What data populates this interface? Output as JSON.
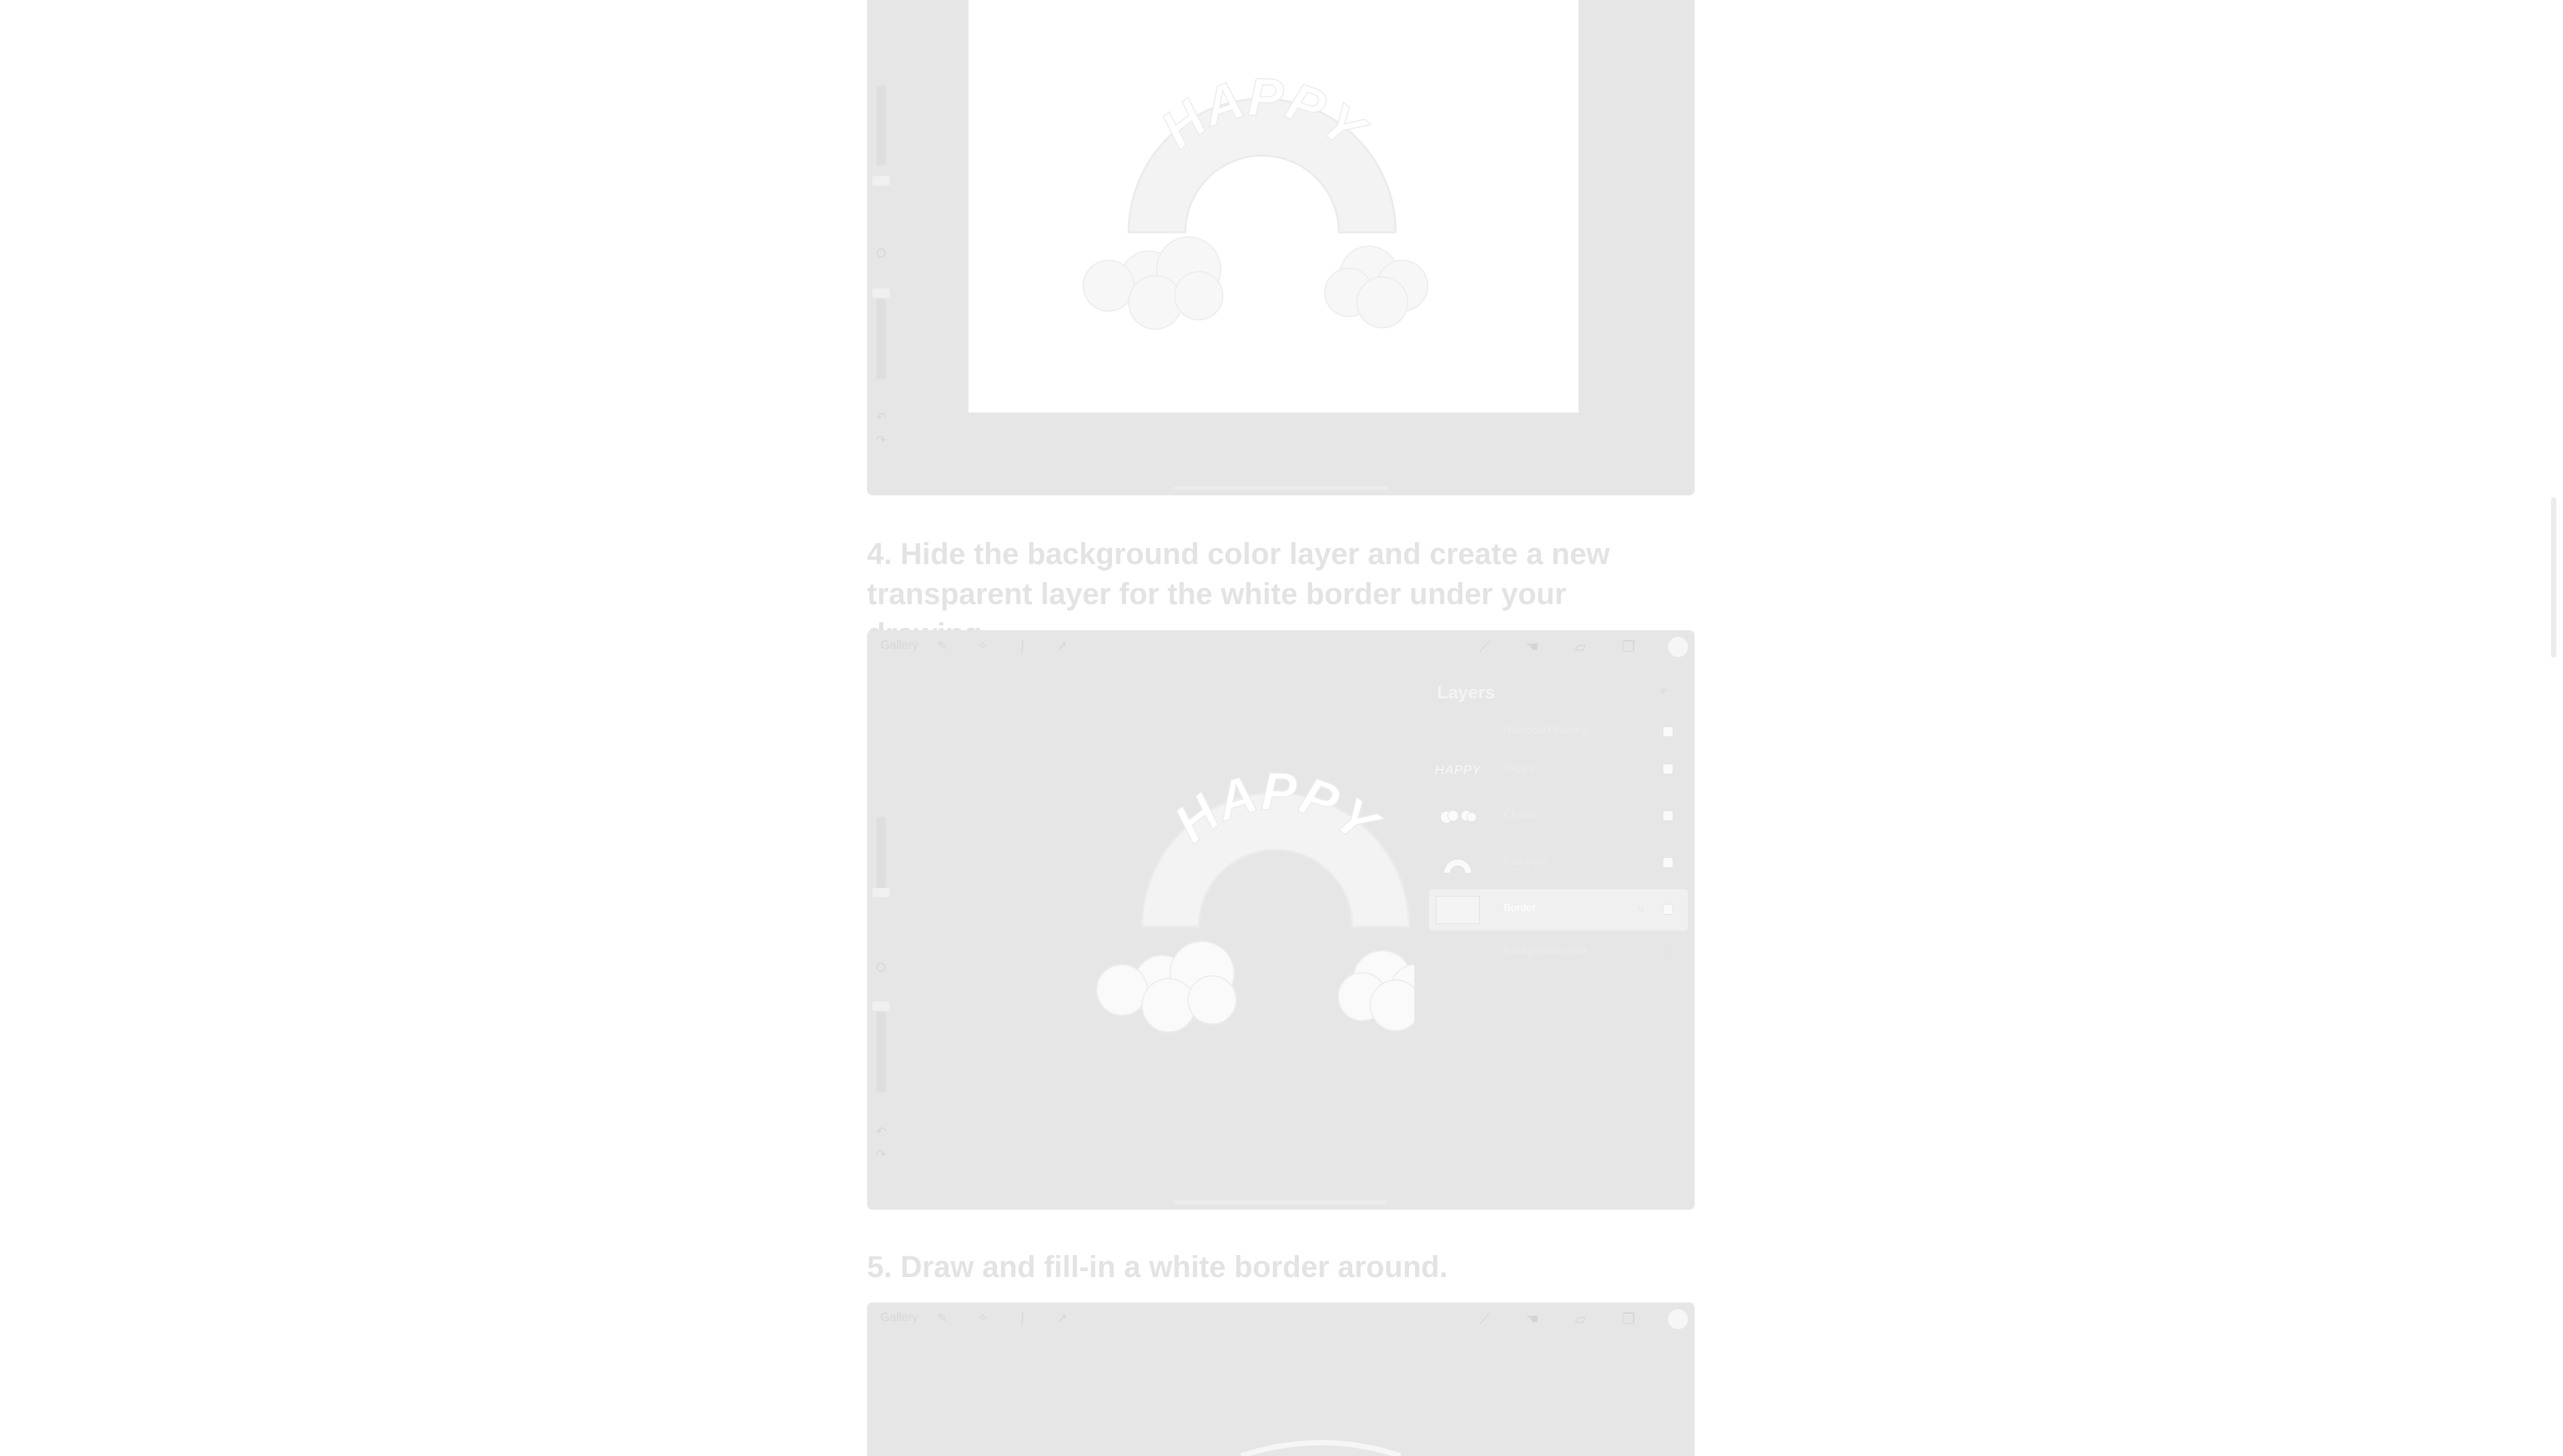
{
  "steps": [
    {
      "heading": "4. Hide the background color layer and create a new transparent layer for the white border under your drawing."
    },
    {
      "heading": "5. Draw and fill-in a white border around."
    }
  ],
  "app_toolbar": {
    "gallery_label": "Gallery",
    "tools_left": [
      "wrench-icon",
      "magic-wand-icon",
      "selection-icon",
      "transform-arrow-icon"
    ],
    "tools_right": [
      "brush-icon",
      "smudge-icon",
      "eraser-icon",
      "layers-icon",
      "color-swatch"
    ]
  },
  "artwork": {
    "text": "HAPPY"
  },
  "layers_panel": {
    "title": "Layers",
    "add_label": "+",
    "rows": [
      {
        "name": "Rainbow Drawing",
        "n": "N",
        "thumb": "group"
      },
      {
        "name": "Happy",
        "n": "N",
        "thumb": "happy-text"
      },
      {
        "name": "Clouds",
        "n": "N",
        "thumb": "clouds"
      },
      {
        "name": "Rainbow",
        "n": "N",
        "thumb": "rainbow"
      },
      {
        "name": "Border",
        "n": "N",
        "thumb": "empty",
        "selected": true
      },
      {
        "name": "Background color",
        "n": "",
        "thumb": "background"
      }
    ]
  },
  "colors": {
    "page_bg": "#ffffff",
    "screenshot_bg": "#e6e6e6",
    "heading_text": "#e3e3e3"
  }
}
